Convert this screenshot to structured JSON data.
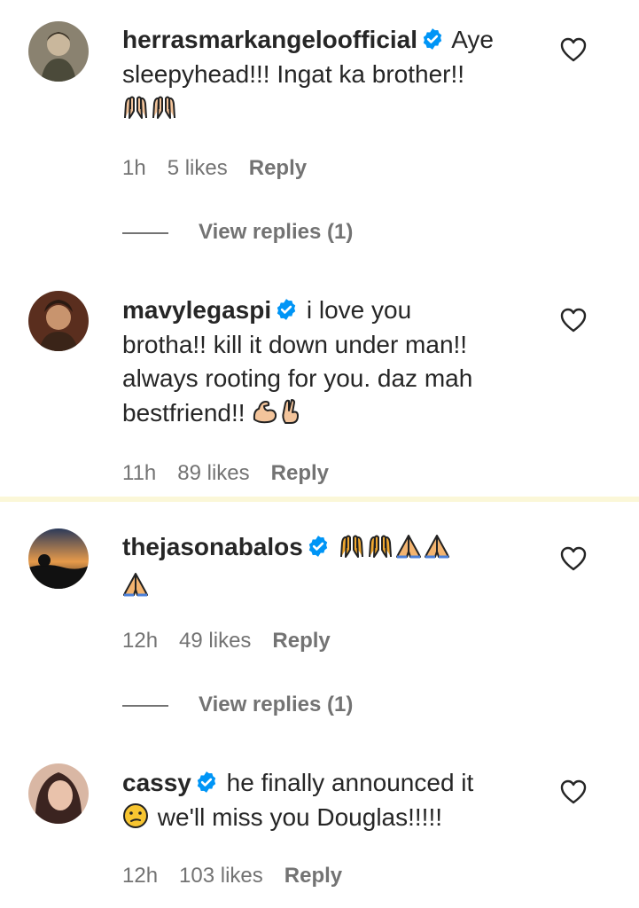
{
  "comments": [
    {
      "username": "herrasmarkangeloofficial",
      "text_first": "Aye",
      "text_lines": [
        "sleepyhead!!! Ingat ka brother!!"
      ],
      "emojis": [
        "praise-hands",
        "praise-hands"
      ],
      "time": "1h",
      "likes": "5 likes",
      "reply": "Reply",
      "view_replies": "View replies (1)"
    },
    {
      "username": "mavylegaspi",
      "text_first": "i love you",
      "text_lines": [
        "brotha!! kill it down under man!!",
        "always rooting for you. daz mah",
        "bestfriend!!"
      ],
      "emojis": [
        "flexed-biceps",
        "crossed-fingers"
      ],
      "time": "11h",
      "likes": "89 likes",
      "reply": "Reply"
    },
    {
      "username": "thejasonabalos",
      "text_first": "",
      "emojis": [
        "praise-hands",
        "praise-hands",
        "folded-hands",
        "folded-hands",
        "folded-hands"
      ],
      "time": "12h",
      "likes": "49 likes",
      "reply": "Reply",
      "view_replies": "View replies (1)"
    },
    {
      "username": "cassy",
      "text_first": "he finally announced it",
      "text_second": "we'll miss you Douglas!!!!!",
      "emojis": [
        "confused-face"
      ],
      "time": "12h",
      "likes": "103 likes",
      "reply": "Reply"
    }
  ],
  "colors": {
    "text": "#262626",
    "meta": "#737373",
    "verified": "#0095f6",
    "divider": "#fbf7d8"
  }
}
